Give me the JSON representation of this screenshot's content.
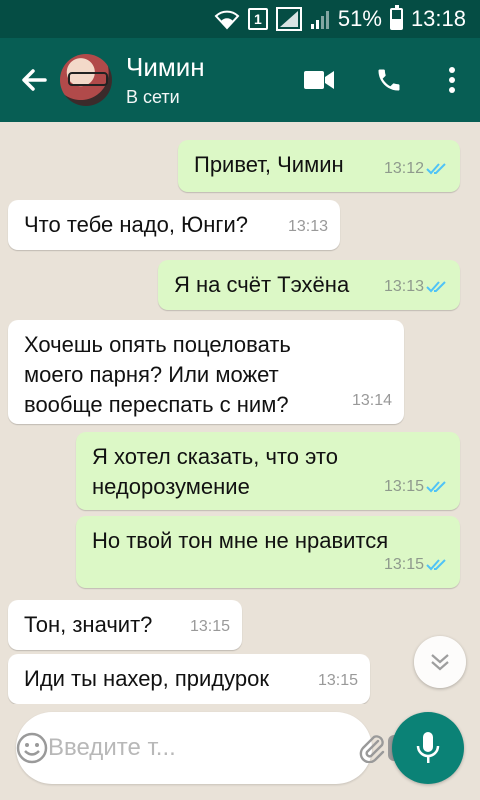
{
  "status_bar": {
    "sim_label": "1",
    "battery": "51%",
    "time": "13:18"
  },
  "header": {
    "contact_name": "Чимин",
    "contact_status": "В сети",
    "icons": [
      "back-arrow-icon",
      "video-call-icon",
      "phone-call-icon",
      "more-vert-icon"
    ]
  },
  "messages": [
    {
      "dir": "out",
      "text": "Привет, Чимин",
      "time": "13:12",
      "read": true
    },
    {
      "dir": "in",
      "text": "Что тебе надо, Юнги?",
      "time": "13:13"
    },
    {
      "dir": "out",
      "text": "Я на счёт Тэхёна",
      "time": "13:13",
      "read": true
    },
    {
      "dir": "in",
      "lines": [
        "Хочешь опять поцеловать",
        "моего парня? Или может",
        "вообще переспать с ним?"
      ],
      "time": "13:14"
    },
    {
      "dir": "out",
      "lines": [
        "Я хотел сказать, что это",
        "недорозумение"
      ],
      "time": "13:15",
      "read": true
    },
    {
      "dir": "out",
      "text": "Но твой тон мне не нравится",
      "time": "13:15",
      "read": true
    },
    {
      "dir": "in",
      "text": "Тон, значит?",
      "time": "13:15"
    },
    {
      "dir": "in",
      "text": "Иди ты нахер, придурок",
      "time": "13:15"
    }
  ],
  "composer": {
    "placeholder": "Введите т..."
  },
  "colors": {
    "header": "#075e54",
    "status_bar": "#054d44",
    "outgoing_bubble": "#dcf8c6",
    "incoming_bubble": "#ffffff",
    "read_ticks": "#4fc3f7",
    "mic_button": "#0b8276"
  }
}
